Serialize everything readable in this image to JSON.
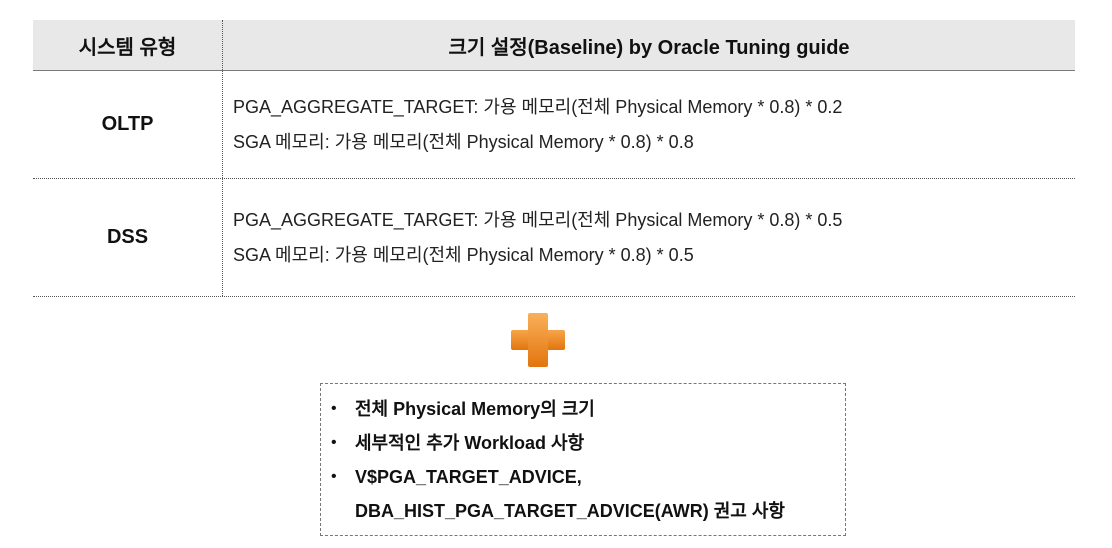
{
  "table": {
    "header": {
      "col1": "시스템 유형",
      "col2": "크기 설정(Baseline) by Oracle Tuning guide"
    },
    "rows": [
      {
        "type": "OLTP",
        "lines": [
          "PGA_AGGREGATE_TARGET: 가용 메모리(전체 Physical Memory * 0.8) * 0.2",
          "SGA 메모리: 가용 메모리(전체 Physical Memory * 0.8) * 0.8"
        ]
      },
      {
        "type": "DSS",
        "lines": [
          "PGA_AGGREGATE_TARGET: 가용 메모리(전체 Physical Memory * 0.8) * 0.5",
          "SGA 메모리: 가용 메모리(전체 Physical Memory * 0.8) * 0.5"
        ]
      }
    ]
  },
  "plus_icon": {
    "icon": "plus-icon",
    "color": "#ee8a22"
  },
  "notes": {
    "bullet": "•",
    "items": [
      {
        "lines": [
          "전체 Physical Memory의 크기"
        ]
      },
      {
        "lines": [
          "세부적인 추가 Workload 사항"
        ]
      },
      {
        "lines": [
          "V$PGA_TARGET_ADVICE,",
          "DBA_HIST_PGA_TARGET_ADVICE(AWR) 권고 사항"
        ]
      }
    ]
  }
}
